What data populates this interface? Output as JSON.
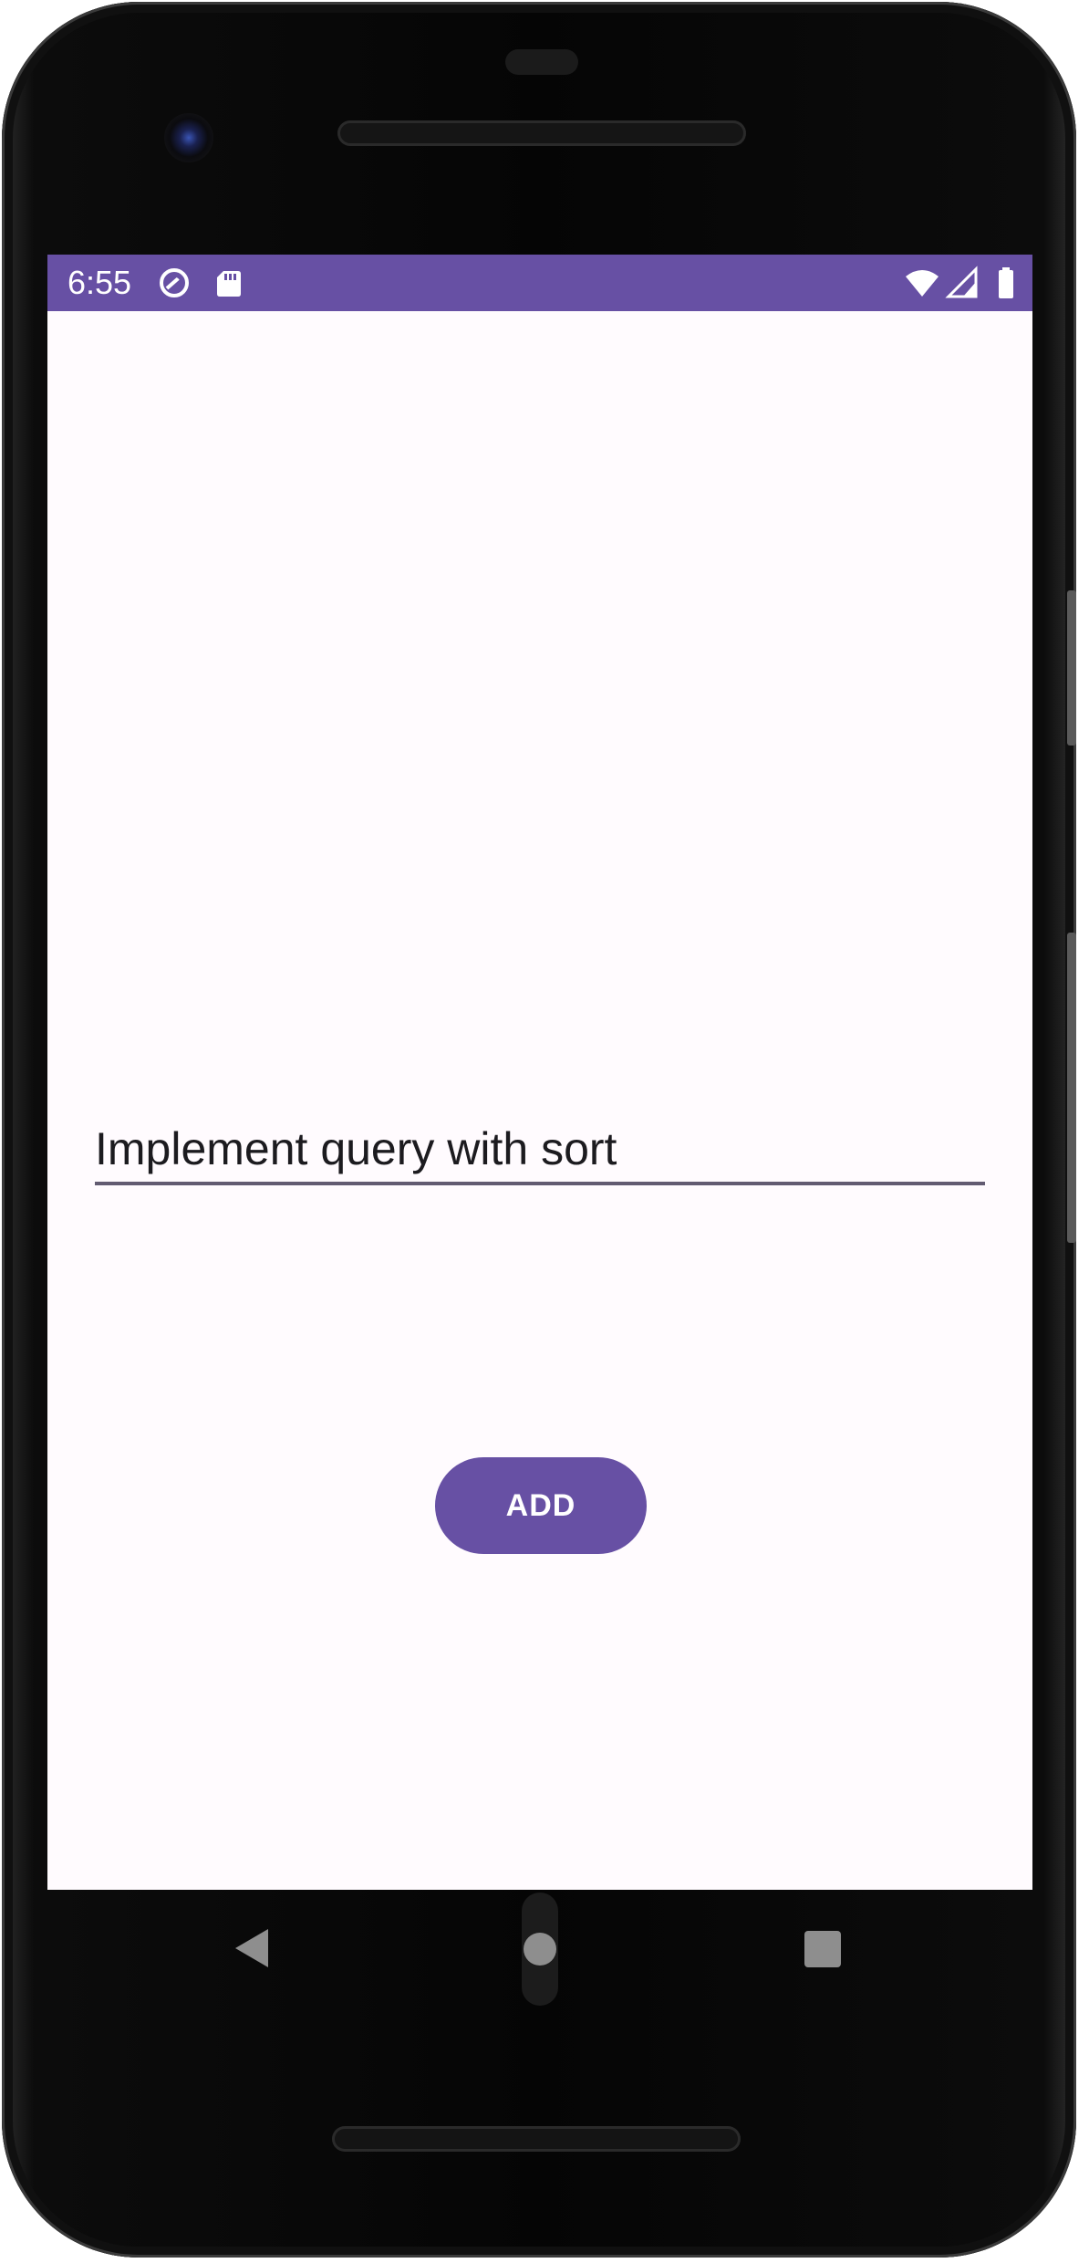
{
  "status_bar": {
    "time": "6:55",
    "background_color": "#6750a4",
    "left_icons": [
      "sync-icon",
      "sd-card-icon"
    ],
    "right_icons": [
      "wifi-icon",
      "cell-signal-icon",
      "battery-icon"
    ]
  },
  "main": {
    "text_field": {
      "value": "Implement query with sort"
    },
    "add_button": {
      "label": "ADD"
    },
    "background_color": "#fffbfe",
    "accent_color": "#6750a4"
  },
  "nav_bar": {
    "icons": [
      "back-icon",
      "home-icon",
      "recents-icon"
    ]
  }
}
